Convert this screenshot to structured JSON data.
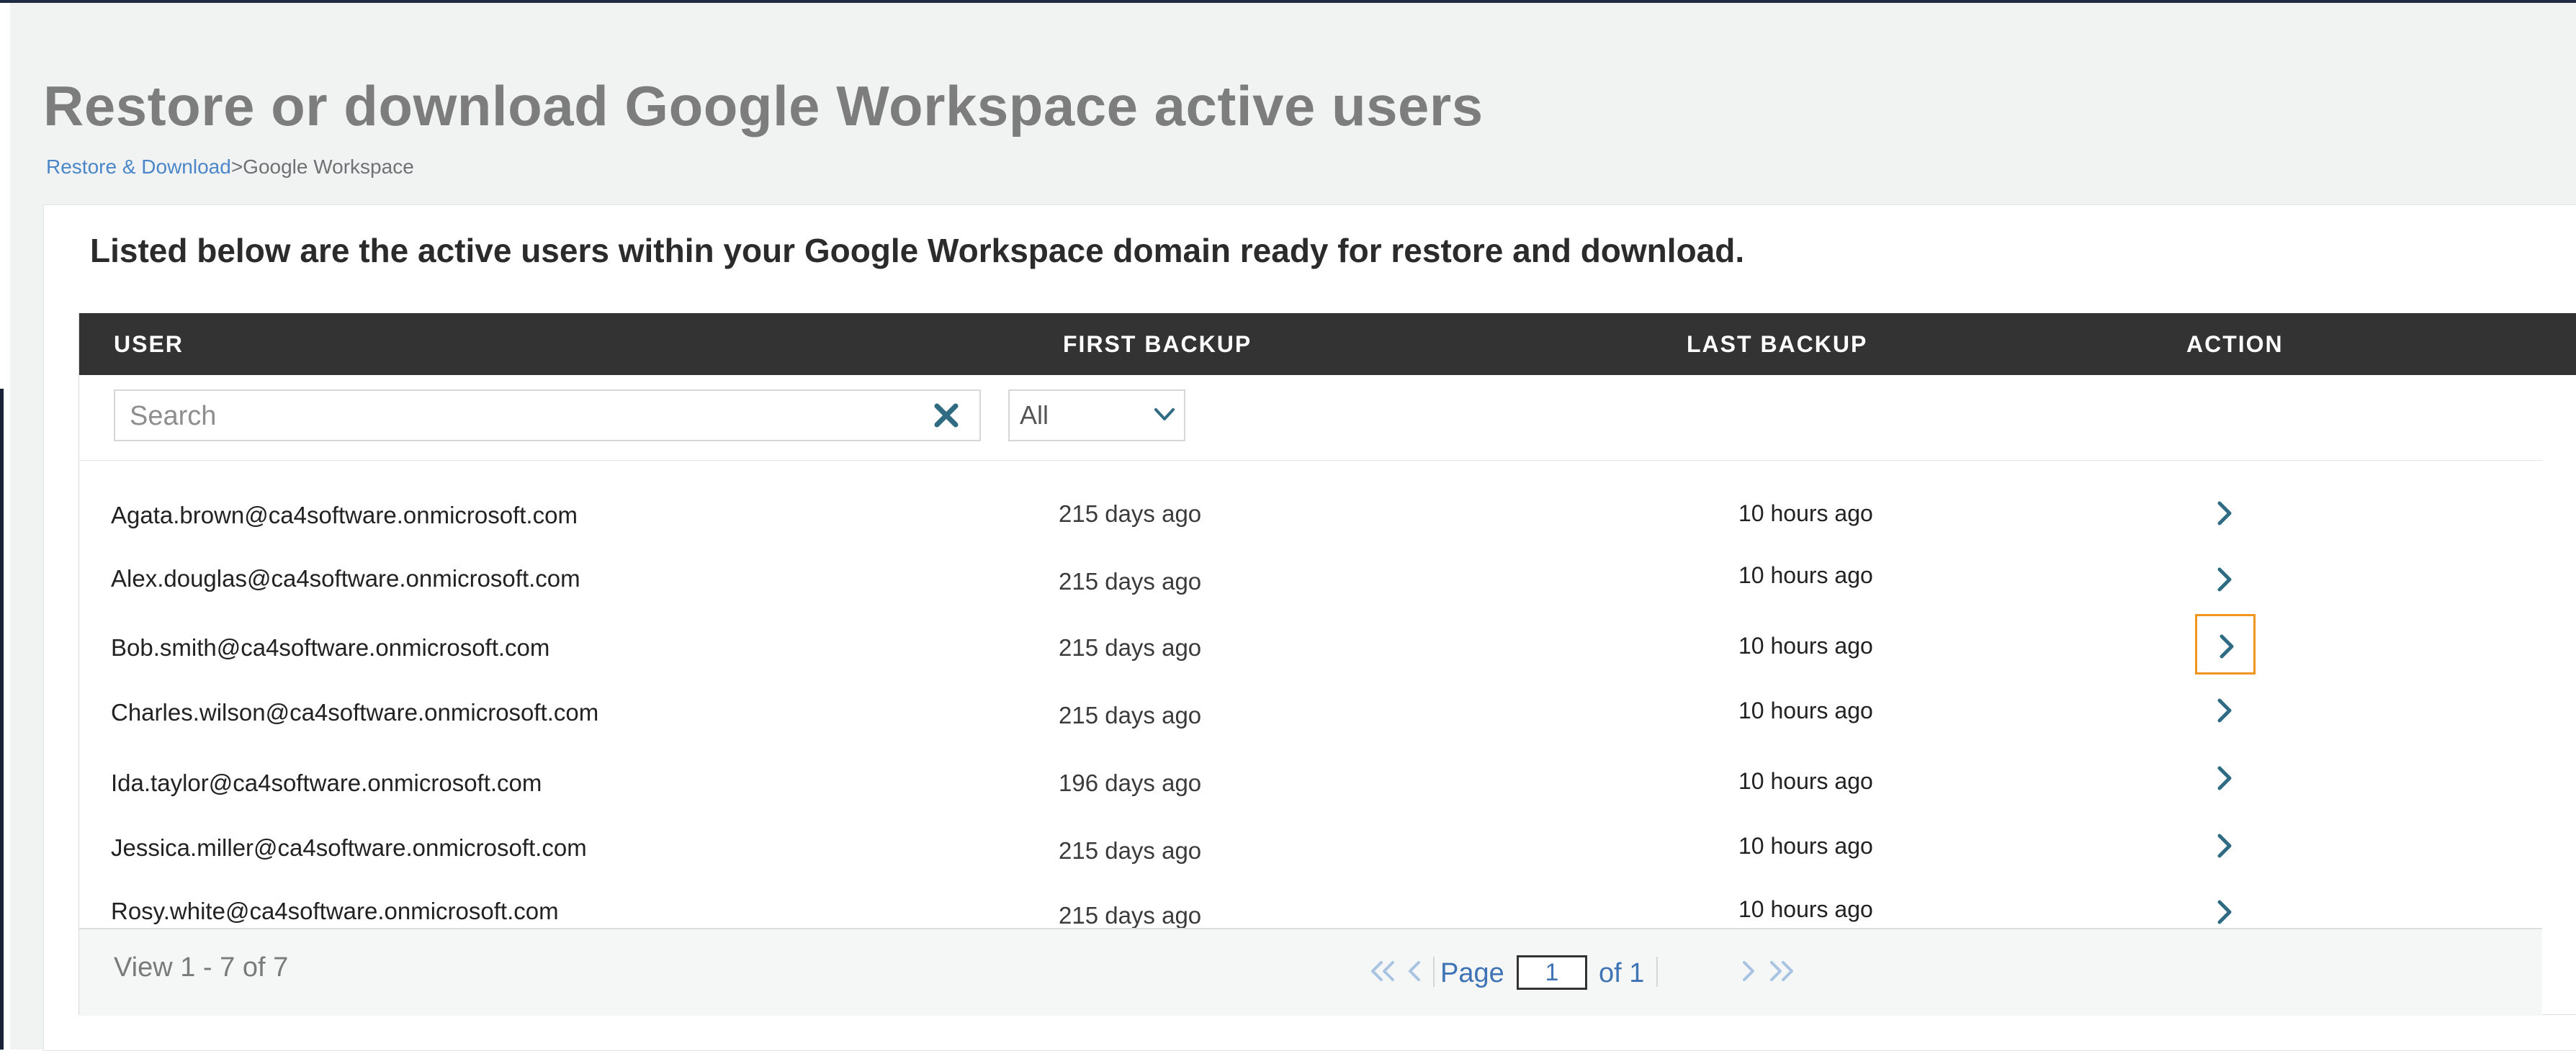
{
  "page": {
    "title": "Restore or download Google Workspace active users",
    "breadcrumb": {
      "link": "Restore & Download",
      "separator": ">",
      "current": "Google Workspace"
    },
    "intro": "Listed below are the active users within your Google Workspace domain ready for restore and download."
  },
  "table": {
    "columns": {
      "user": "USER",
      "first_backup": "FIRST BACKUP",
      "last_backup": "LAST BACKUP",
      "action": "ACTION"
    },
    "search_placeholder": "Search",
    "filter_selected": "All",
    "rows": [
      {
        "user": "Agata.brown@ca4software.onmicrosoft.com",
        "first_backup": "215 days ago",
        "last_backup": "10 hours ago"
      },
      {
        "user": "Alex.douglas@ca4software.onmicrosoft.com",
        "first_backup": "215 days ago",
        "last_backup": "10 hours ago"
      },
      {
        "user": "Bob.smith@ca4software.onmicrosoft.com",
        "first_backup": "215 days ago",
        "last_backup": "10 hours ago"
      },
      {
        "user": "Charles.wilson@ca4software.onmicrosoft.com",
        "first_backup": "215 days ago",
        "last_backup": "10 hours ago"
      },
      {
        "user": "Ida.taylor@ca4software.onmicrosoft.com",
        "first_backup": "196 days ago",
        "last_backup": "10 hours ago"
      },
      {
        "user": "Jessica.miller@ca4software.onmicrosoft.com",
        "first_backup": "215 days ago",
        "last_backup": "10 hours ago"
      },
      {
        "user": "Rosy.white@ca4software.onmicrosoft.com",
        "first_backup": "215 days ago",
        "last_backup": "10 hours ago"
      }
    ],
    "focused_row": 2
  },
  "pagination": {
    "view_text": "View 1 - 7 of 7",
    "page_label": "Page",
    "current_page": "1",
    "of_text": "of 1"
  },
  "icons": {
    "clear": "close-x-icon",
    "select": "chevron-down-icon",
    "action": "chevron-right-icon",
    "first": "double-chevron-left-icon",
    "prev": "chevron-left-icon",
    "next": "chevron-right-icon",
    "last": "double-chevron-right-icon"
  },
  "colors": {
    "header_bg": "#333333",
    "accent_teal": "#2f6b82",
    "focus_orange": "#f0961e",
    "link_blue": "#4a86c8"
  }
}
